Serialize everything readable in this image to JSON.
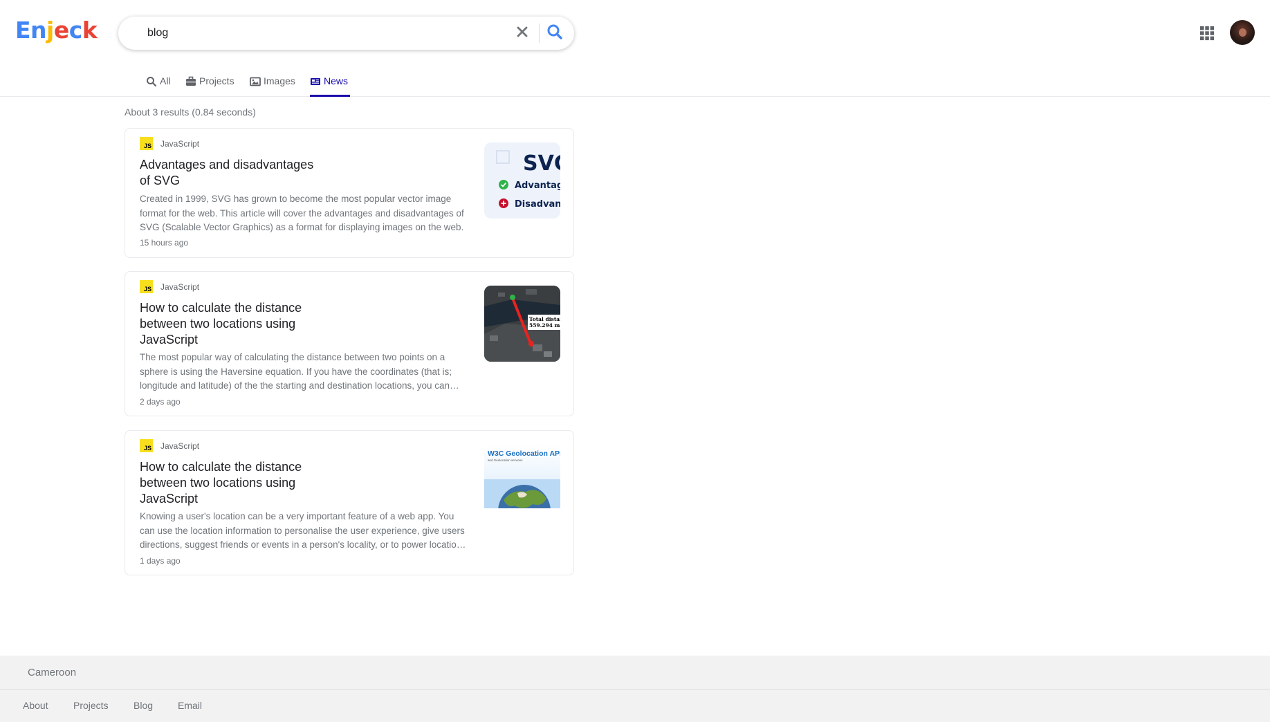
{
  "app": {
    "logo_letters": [
      {
        "char": "E",
        "color": "#4285f4"
      },
      {
        "char": "n",
        "color": "#4285f4"
      },
      {
        "char": "j",
        "color": "#fbbc05"
      },
      {
        "char": "e",
        "color": "#ea4335"
      },
      {
        "char": "c",
        "color": "#4285f4"
      },
      {
        "char": "k",
        "color": "#ea4335"
      }
    ]
  },
  "search": {
    "query": "blog",
    "clear_icon": "close-icon",
    "search_icon": "search-icon"
  },
  "tabs": [
    {
      "label": "All",
      "icon": "search-icon",
      "active": false
    },
    {
      "label": "Projects",
      "icon": "briefcase-icon",
      "active": false
    },
    {
      "label": "Images",
      "icon": "image-icon",
      "active": false
    },
    {
      "label": "News",
      "icon": "newspaper-icon",
      "active": true
    }
  ],
  "results": {
    "stats": "About 3 results (0.84 seconds)",
    "items": [
      {
        "source": "JavaScript",
        "badge": "JS",
        "title": "Advantages and disadvantages of SVG",
        "snippet": "Created in 1999, SVG has grown to become the most popular vector image format for the web. This article will cover the advantages and disadvantages of SVG (Scalable Vector Graphics) as a format for displaying images on the web.",
        "time": "15 hours ago",
        "thumb": {
          "heading": "SVG",
          "line1": "Advantages",
          "line2": "Disadvantages"
        }
      },
      {
        "source": "JavaScript",
        "badge": "JS",
        "title": "How to calculate the distance between two locations using JavaScript",
        "snippet": "The most popular way of calculating the distance between two points on a sphere is using the Haversine equation. If you have the coordinates (that is; longitude and latitude) of the the starting and destination locations, you can easily calculate the distance.",
        "time": "2 days ago",
        "thumb": {
          "label1": "Total distance",
          "label2": "559.294 m"
        }
      },
      {
        "source": "JavaScript",
        "badge": "JS",
        "title": "How to calculate the distance between two locations using JavaScript",
        "snippet": "Knowing a user's location can be a very important feature of a web app. You can use the location information to personalise the user experience, give users directions, suggest friends or events in a person's locality, or to power location-based features.",
        "time": "1 days ago",
        "thumb": {
          "heading": "W3C Geolocation API",
          "sub": "and Geolocation services"
        }
      }
    ]
  },
  "footer": {
    "country": "Cameroon",
    "links": [
      "About",
      "Projects",
      "Blog",
      "Email"
    ]
  }
}
